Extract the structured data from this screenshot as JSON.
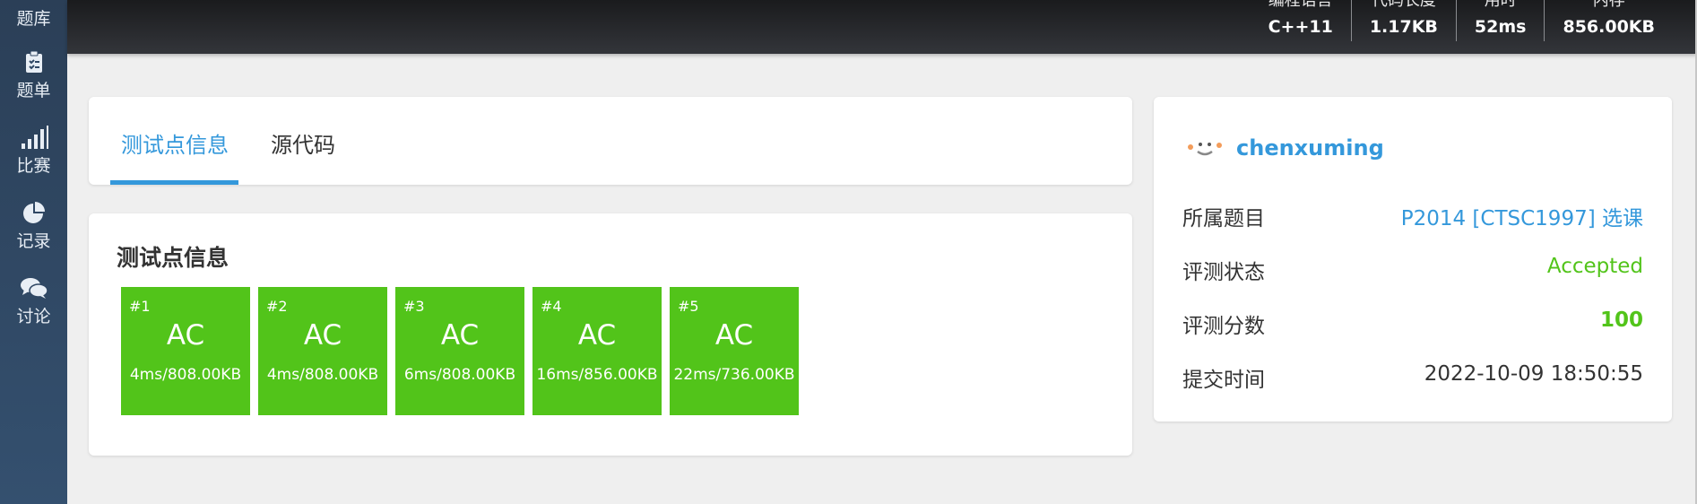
{
  "sidebar": {
    "items": [
      {
        "label": "题库",
        "icon": "book-icon"
      },
      {
        "label": "题单",
        "icon": "clipboard-icon"
      },
      {
        "label": "比赛",
        "icon": "bar-chart-icon"
      },
      {
        "label": "记录",
        "icon": "pie-chart-icon"
      },
      {
        "label": "讨论",
        "icon": "chat-icon"
      }
    ]
  },
  "header": {
    "stats": [
      {
        "label": "编程语言",
        "value": "C++11"
      },
      {
        "label": "代码长度",
        "value": "1.17KB"
      },
      {
        "label": "用时",
        "value": "52ms"
      },
      {
        "label": "内存",
        "value": "856.00KB"
      }
    ]
  },
  "tabs": [
    {
      "label": "测试点信息",
      "active": true
    },
    {
      "label": "源代码",
      "active": false
    }
  ],
  "tests": {
    "title": "测试点信息",
    "cases": [
      {
        "id": "#1",
        "status": "AC",
        "detail": "4ms/808.00KB"
      },
      {
        "id": "#2",
        "status": "AC",
        "detail": "4ms/808.00KB"
      },
      {
        "id": "#3",
        "status": "AC",
        "detail": "6ms/808.00KB"
      },
      {
        "id": "#4",
        "status": "AC",
        "detail": "16ms/856.00KB"
      },
      {
        "id": "#5",
        "status": "AC",
        "detail": "22ms/736.00KB"
      }
    ],
    "color": "#52c41a"
  },
  "info": {
    "username": "chenxuming",
    "problem_label": "所属题目",
    "problem_value": "P2014 [CTSC1997] 选课",
    "status_label": "评测状态",
    "status_value": "Accepted",
    "score_label": "评测分数",
    "score_value": "100",
    "time_label": "提交时间",
    "time_value": "2022-10-09 18:50:55"
  },
  "colors": {
    "accent": "#3498db",
    "accepted": "#52c41a",
    "sidebar": "#2b3f57"
  }
}
